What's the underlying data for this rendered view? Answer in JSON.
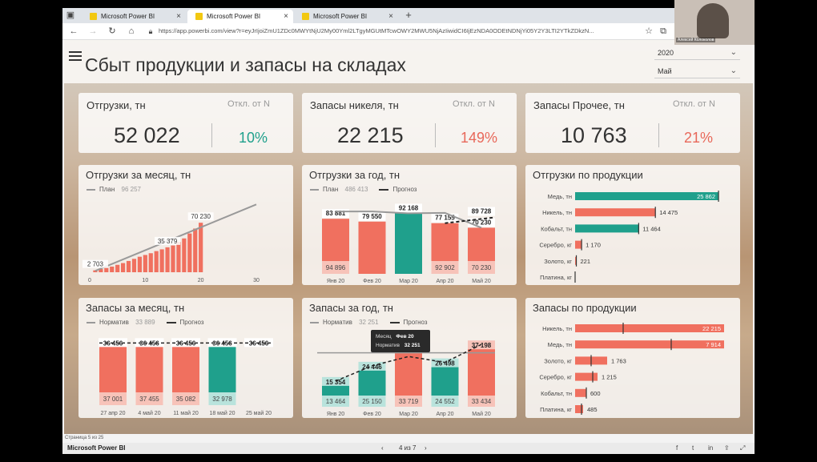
{
  "browser": {
    "tabs": [
      {
        "label": "Microsoft Power BI",
        "active": false
      },
      {
        "label": "Microsoft Power BI",
        "active": true
      },
      {
        "label": "Microsoft Power BI",
        "active": false
      }
    ],
    "url": "https://app.powerbi.com/view?r=eyJrIjoiZmU1ZDc0MWYtNjU2My00Yml2LTgyMGUtMTcwOWY2MWU5NjAzIiwidCI6IjEzNDA0ODEtNDNjYi05Y2Y3LTI2YTkZDkzN..."
  },
  "webcam": {
    "name": "Алексей Колоколов"
  },
  "report": {
    "title": "Сбыт продукции и запасы на складах",
    "year": "2020",
    "month": "Май",
    "kpis": [
      {
        "title": "Отгрузки, тн",
        "dev_label": "Откл. от N",
        "value": "52 022",
        "pct": "10%",
        "pct_color": "#1fa08c"
      },
      {
        "title": "Запасы никеля, тн",
        "dev_label": "Откл. от N",
        "value": "22 215",
        "pct": "149%",
        "pct_color": "#e8685a"
      },
      {
        "title": "Запасы Прочее, тн",
        "dev_label": "Откл. от N",
        "value": "10 763",
        "pct": "21%",
        "pct_color": "#e8685a"
      }
    ],
    "legend_plan": "План",
    "legend_norm": "Норматив",
    "legend_forecast": "Прогноз",
    "page_status": "Страница 5 из 25",
    "footer_brand": "Microsoft Power BI",
    "pager": "4 из 7"
  },
  "colors": {
    "teal": "#1fa08c",
    "red": "#f0705f",
    "lightteal": "#b9e3dc",
    "lightred": "#f7c3b9"
  },
  "chart_data": [
    {
      "type": "bar",
      "title": "Отгрузки за месяц, тн",
      "legend_value": "96 257",
      "x": [
        1,
        2,
        3,
        4,
        5,
        6,
        7,
        8,
        9,
        10,
        11,
        12,
        13,
        14,
        15,
        16,
        17,
        18,
        19,
        20
      ],
      "values": [
        2703,
        4500,
        6200,
        8000,
        10500,
        13000,
        16000,
        19000,
        22000,
        24500,
        27000,
        30000,
        32500,
        35379,
        38000,
        43000,
        48000,
        55000,
        62000,
        70230
      ],
      "value_labels": [
        "2 703",
        "35 379",
        "70 230"
      ],
      "plan_line": [
        [
          1,
          2000
        ],
        [
          30,
          96257
        ]
      ],
      "xticks": [
        "0",
        "10",
        "20",
        "30"
      ]
    },
    {
      "type": "bar",
      "title": "Отгрузки за год, тн",
      "legend_value": "486 413",
      "categories": [
        "Янв 20",
        "Фев 20",
        "Мар 20",
        "Апр 20",
        "Май 20"
      ],
      "values": [
        83881,
        79550,
        92168,
        77155,
        70230
      ],
      "value_labels": [
        "83 881",
        "79 550",
        "92 168",
        "77 155",
        "70 230"
      ],
      "plan": [
        94896,
        94896,
        92168,
        92902,
        70230
      ],
      "plan_labels": [
        "94 896",
        "",
        "",
        "92 902",
        "70 230"
      ],
      "forecast_label": "89 728",
      "colors": [
        "red",
        "red",
        "teal",
        "red",
        "red"
      ]
    },
    {
      "type": "bar",
      "title": "Отгрузки по продукции",
      "categories": [
        "Медь, тн",
        "Никель, тн",
        "Кобальт, тн",
        "Серебро, кг",
        "Золото, кг",
        "Платина, кг"
      ],
      "values": [
        25862,
        14475,
        11464,
        1170,
        221,
        0
      ],
      "value_labels": [
        "25 862",
        "14 475",
        "11 464",
        "1 170",
        "221",
        ""
      ],
      "colors": [
        "teal",
        "red",
        "teal",
        "red",
        "red",
        "red"
      ]
    },
    {
      "type": "bar",
      "title": "Запасы за месяц, тн",
      "legend_value": "33 889",
      "categories": [
        "27 апр 20",
        "4 май 20",
        "11 май 20",
        "18 май 20",
        "25 май 20"
      ],
      "values": [
        37001,
        37455,
        35082,
        32978,
        0
      ],
      "value_labels": [
        "37 001",
        "37 455",
        "35 082",
        "32 978",
        ""
      ],
      "forecast_labels": [
        "36 456",
        "36 456",
        "36 456",
        "36 456",
        "36 456"
      ],
      "colors": [
        "red",
        "red",
        "red",
        "teal",
        "red"
      ]
    },
    {
      "type": "bar",
      "title": "Запасы за год, тн",
      "legend_value": "32 251",
      "categories": [
        "Янв 20",
        "Фев 20",
        "Мар 20",
        "Апр 20",
        "Май 20"
      ],
      "values": [
        13464,
        25150,
        33719,
        24552,
        33434
      ],
      "forecast": [
        15354,
        24446,
        30000,
        26498,
        37198
      ],
      "forecast_labels": [
        "15 354",
        "24 446",
        "",
        "26 498",
        "37 198"
      ],
      "value_labels": [
        "13 464",
        "25 150",
        "33 719",
        "24 552",
        "33 434"
      ],
      "colors": [
        "teal",
        "teal",
        "red",
        "teal",
        "red"
      ],
      "tooltip": {
        "k1": "Месяц",
        "v1": "Фев 20",
        "k2": "Норматив",
        "v2": "32 251"
      }
    },
    {
      "type": "bar",
      "title": "Запасы по продукции",
      "categories": [
        "Никель, тн",
        "Медь, тн",
        "Золото, кг",
        "Серебро, кг",
        "Кобальт, тн",
        "Платина, кг"
      ],
      "values": [
        22215,
        7914,
        1763,
        1215,
        600,
        485
      ],
      "value_labels": [
        "22 215",
        "7 914",
        "1 763",
        "1 215",
        "600",
        "485"
      ]
    }
  ]
}
